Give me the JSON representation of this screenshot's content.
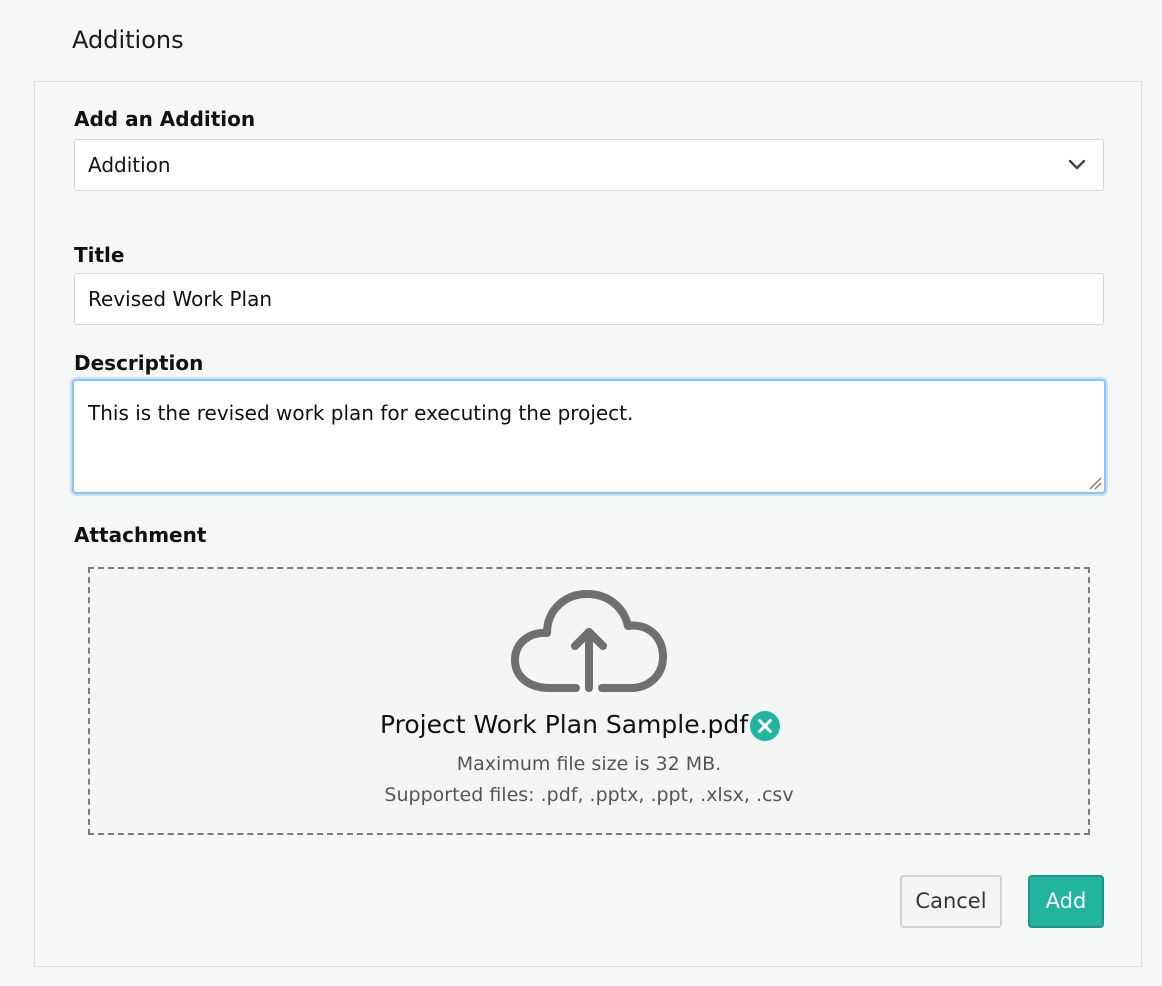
{
  "page": {
    "title": "Additions"
  },
  "form": {
    "addition_type": {
      "label": "Add an Addition",
      "selected": "Addition"
    },
    "title_field": {
      "label": "Title",
      "value": "Revised Work Plan"
    },
    "description_field": {
      "label": "Description",
      "value": "This is the revised work plan for executing the project."
    },
    "attachment": {
      "label": "Attachment",
      "file_name": "Project Work Plan Sample.pdf",
      "max_size_text": "Maximum file size is 32 MB.",
      "supported_text": "Supported files: .pdf, .pptx, .ppt, .xlsx, .csv"
    }
  },
  "actions": {
    "cancel_label": "Cancel",
    "add_label": "Add"
  },
  "icons": {
    "select": "chevron-down-icon",
    "upload": "cloud-upload-icon",
    "remove": "remove-circle-icon",
    "resize": "resize-grip-icon"
  },
  "colors": {
    "accent": "#21b49f",
    "focus_border": "#8ec2f2",
    "icon_gray": "#6f6f6f"
  }
}
